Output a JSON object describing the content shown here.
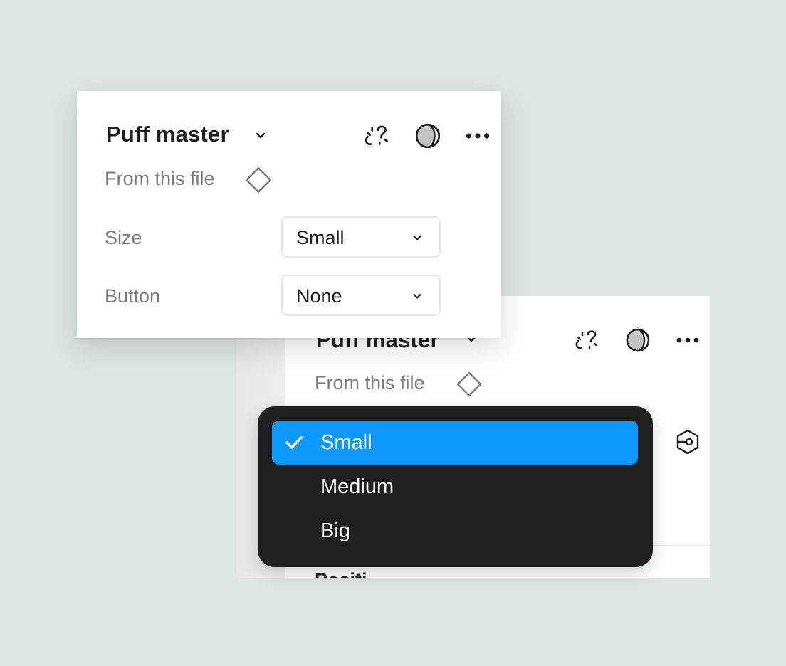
{
  "front_panel": {
    "title": "Puff master",
    "subtitle": "From this file",
    "icons": [
      "chevron-down-icon",
      "detach-link-icon",
      "contrast-icon",
      "more-icon",
      "diamond-component-icon"
    ],
    "properties": [
      {
        "label": "Size",
        "value": "Small"
      },
      {
        "label": "Button",
        "value": "None"
      }
    ]
  },
  "back_panel": {
    "title": "Puff master",
    "subtitle": "From this file",
    "section_label": "Positi",
    "icons": [
      "chevron-down-icon",
      "detach-link-icon",
      "contrast-icon",
      "more-icon",
      "diamond-component-icon",
      "instance-swap-icon"
    ]
  },
  "dropdown": {
    "options": [
      "Small",
      "Medium",
      "Big"
    ],
    "selected": "Small",
    "selected_color": "#0d99ff",
    "background_color": "#1f1f1f"
  }
}
